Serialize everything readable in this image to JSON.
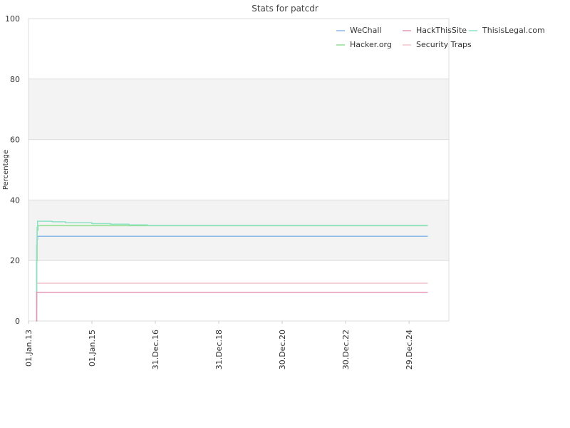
{
  "chart_data": {
    "type": "line",
    "title": "Stats for patcdr",
    "xlabel": "",
    "ylabel": "Percentage",
    "ylim": [
      0,
      100
    ],
    "y_ticks": [
      0,
      20,
      40,
      60,
      80,
      100
    ],
    "x_range": [
      "2013-01-01",
      "2026-04-01"
    ],
    "x_ticks": [
      {
        "date": "2013-01-01",
        "label": "01.Jan.13"
      },
      {
        "date": "2015-01-01",
        "label": "01.Jan.15"
      },
      {
        "date": "2016-12-31",
        "label": "31.Dec.16"
      },
      {
        "date": "2018-12-31",
        "label": "31.Dec.18"
      },
      {
        "date": "2020-12-30",
        "label": "30.Dec.20"
      },
      {
        "date": "2022-12-30",
        "label": "30.Dec.22"
      },
      {
        "date": "2024-12-29",
        "label": "29.Dec.24"
      }
    ],
    "grid": "alternating horizontal bands",
    "legend_position": "top-right",
    "series": [
      {
        "name": "WeChall",
        "color": "#8ab8ea",
        "points": [
          [
            "2013-04-01",
            0
          ],
          [
            "2013-04-05",
            25
          ],
          [
            "2013-04-10",
            27
          ],
          [
            "2013-04-15",
            28
          ],
          [
            "2025-08-01",
            28
          ]
        ]
      },
      {
        "name": "Hacker.org",
        "color": "#90e090",
        "points": [
          [
            "2013-04-01",
            5
          ],
          [
            "2013-04-05",
            20
          ],
          [
            "2013-04-10",
            30
          ],
          [
            "2013-04-20",
            31.5
          ],
          [
            "2025-08-01",
            31.5
          ]
        ]
      },
      {
        "name": "HackThisSite",
        "color": "#e595b8",
        "points": [
          [
            "2013-04-01",
            0
          ],
          [
            "2013-04-05",
            9.5
          ],
          [
            "2025-08-01",
            9.5
          ]
        ]
      },
      {
        "name": "Security Traps",
        "color": "#f2c4cc",
        "points": [
          [
            "2013-04-01",
            10
          ],
          [
            "2013-04-05",
            12.5
          ],
          [
            "2025-08-01",
            12.5
          ]
        ]
      },
      {
        "name": "ThisisLegal.com",
        "color": "#8de2c6",
        "points": [
          [
            "2013-04-01",
            10
          ],
          [
            "2013-04-05",
            25
          ],
          [
            "2013-04-10",
            31
          ],
          [
            "2013-04-15",
            33
          ],
          [
            "2013-10-01",
            33
          ],
          [
            "2013-10-02",
            32.8
          ],
          [
            "2014-03-01",
            32.8
          ],
          [
            "2014-03-02",
            32.5
          ],
          [
            "2015-01-01",
            32.5
          ],
          [
            "2015-01-02",
            32.2
          ],
          [
            "2015-08-01",
            32.2
          ],
          [
            "2015-08-02",
            32
          ],
          [
            "2016-03-01",
            32
          ],
          [
            "2016-03-02",
            31.8
          ],
          [
            "2016-10-01",
            31.8
          ],
          [
            "2016-10-02",
            31.6
          ],
          [
            "2025-08-01",
            31.6
          ]
        ]
      }
    ]
  }
}
